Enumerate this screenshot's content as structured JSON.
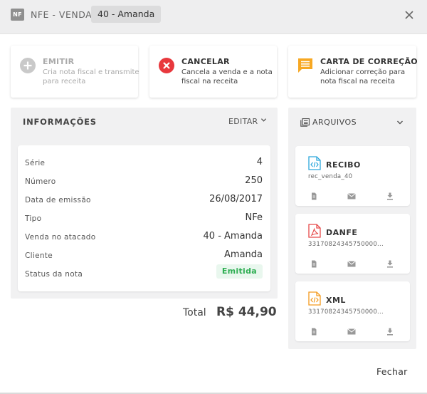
{
  "header": {
    "badge": "NF",
    "title": "NFE - VENDA",
    "chip": "40 - Amanda"
  },
  "actions": {
    "emitir": {
      "title": "EMITIR",
      "desc": "Cria nota fiscal e transmite para receita"
    },
    "cancelar": {
      "title": "CANCELAR",
      "desc": "Cancela a venda e a nota fiscal na receita"
    },
    "carta": {
      "title": "CARTA DE CORREÇÃO",
      "desc": "Adicionar correção para nota fiscal na receita"
    }
  },
  "info": {
    "title": "INFORMAÇÕES",
    "edit_label": "EDITAR",
    "rows": [
      {
        "label": "Série",
        "value": "4"
      },
      {
        "label": "Número",
        "value": "250"
      },
      {
        "label": "Data de emissão",
        "value": "26/08/2017"
      },
      {
        "label": "Tipo",
        "value": "NFe"
      },
      {
        "label": "Venda no atacado",
        "value": "40 - Amanda"
      },
      {
        "label": "Cliente",
        "value": "Amanda"
      },
      {
        "label": "Status da nota",
        "value": "Emitida"
      }
    ]
  },
  "total": {
    "label": "Total",
    "value": "R$ 44,90"
  },
  "files": {
    "title": "ARQUIVOS",
    "items": [
      {
        "name": "RECIBO",
        "sub": "rec_venda_40",
        "icon": "code-file-icon"
      },
      {
        "name": "DANFE",
        "sub": "33170824345750000...",
        "icon": "pdf-file-icon"
      },
      {
        "name": "XML",
        "sub": "33170824345750000...",
        "icon": "code-file-icon"
      }
    ]
  },
  "footer": {
    "close_label": "Fechar"
  },
  "colors": {
    "cancel_red": "#e8383d",
    "carta_orange": "#f7a823",
    "recibo_blue": "#2ca7dc",
    "danfe_red": "#e64a4a",
    "xml_orange": "#f39a1e",
    "status_green": "#2fae53"
  }
}
